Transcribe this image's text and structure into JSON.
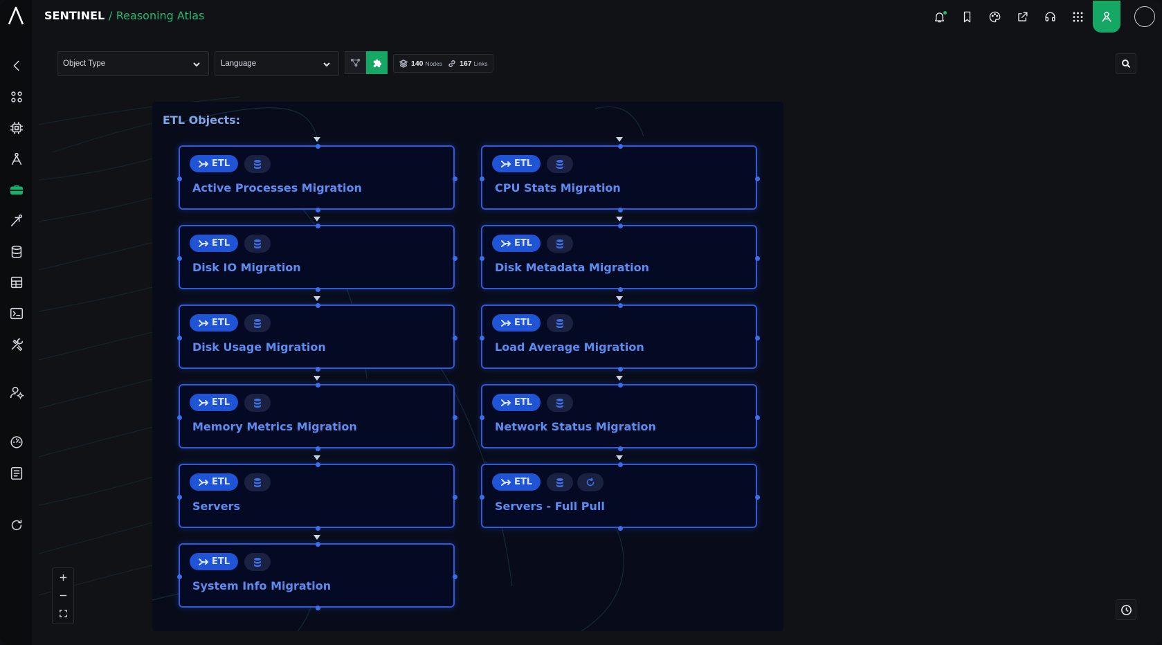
{
  "header": {
    "app_name": "SENTINEL",
    "separator": "/",
    "page_name": "Reasoning Atlas"
  },
  "toolbar": {
    "object_type_label": "Object Type",
    "language_label": "Language",
    "nodes_count": "140",
    "nodes_label": "Nodes",
    "links_count": "167",
    "links_label": "Links"
  },
  "group": {
    "title": "ETL Objects:"
  },
  "chip_label": "ETL",
  "nodes": [
    {
      "title": "Active Processes Migration"
    },
    {
      "title": "CPU Stats Migration"
    },
    {
      "title": "Disk IO Migration"
    },
    {
      "title": "Disk Metadata Migration"
    },
    {
      "title": "Disk Usage Migration"
    },
    {
      "title": "Load Average Migration"
    },
    {
      "title": "Memory Metrics Migration"
    },
    {
      "title": "Network Status Migration"
    },
    {
      "title": "Servers"
    },
    {
      "title": "Servers - Full Pull",
      "extra_icon": "refresh-icon"
    },
    {
      "title": "System Info Migration"
    }
  ],
  "colors": {
    "accent": "#14a864",
    "node_border": "#2f5ad8",
    "node_title": "#5d8cf0",
    "chip": "#1f54d6"
  },
  "icons": {
    "sidebar": [
      "back-icon",
      "apps-icon",
      "chip-icon",
      "pipeline-icon",
      "toolbox-icon",
      "send-icon",
      "database-icon",
      "table-icon",
      "terminal-icon",
      "tools-icon",
      "user-settings-icon",
      "dashboard-icon",
      "list-icon",
      "refresh-icon"
    ],
    "topbar": [
      "bell-icon",
      "bookmark-icon",
      "palette-icon",
      "share-icon",
      "headset-icon",
      "grid-icon",
      "user-icon"
    ]
  }
}
